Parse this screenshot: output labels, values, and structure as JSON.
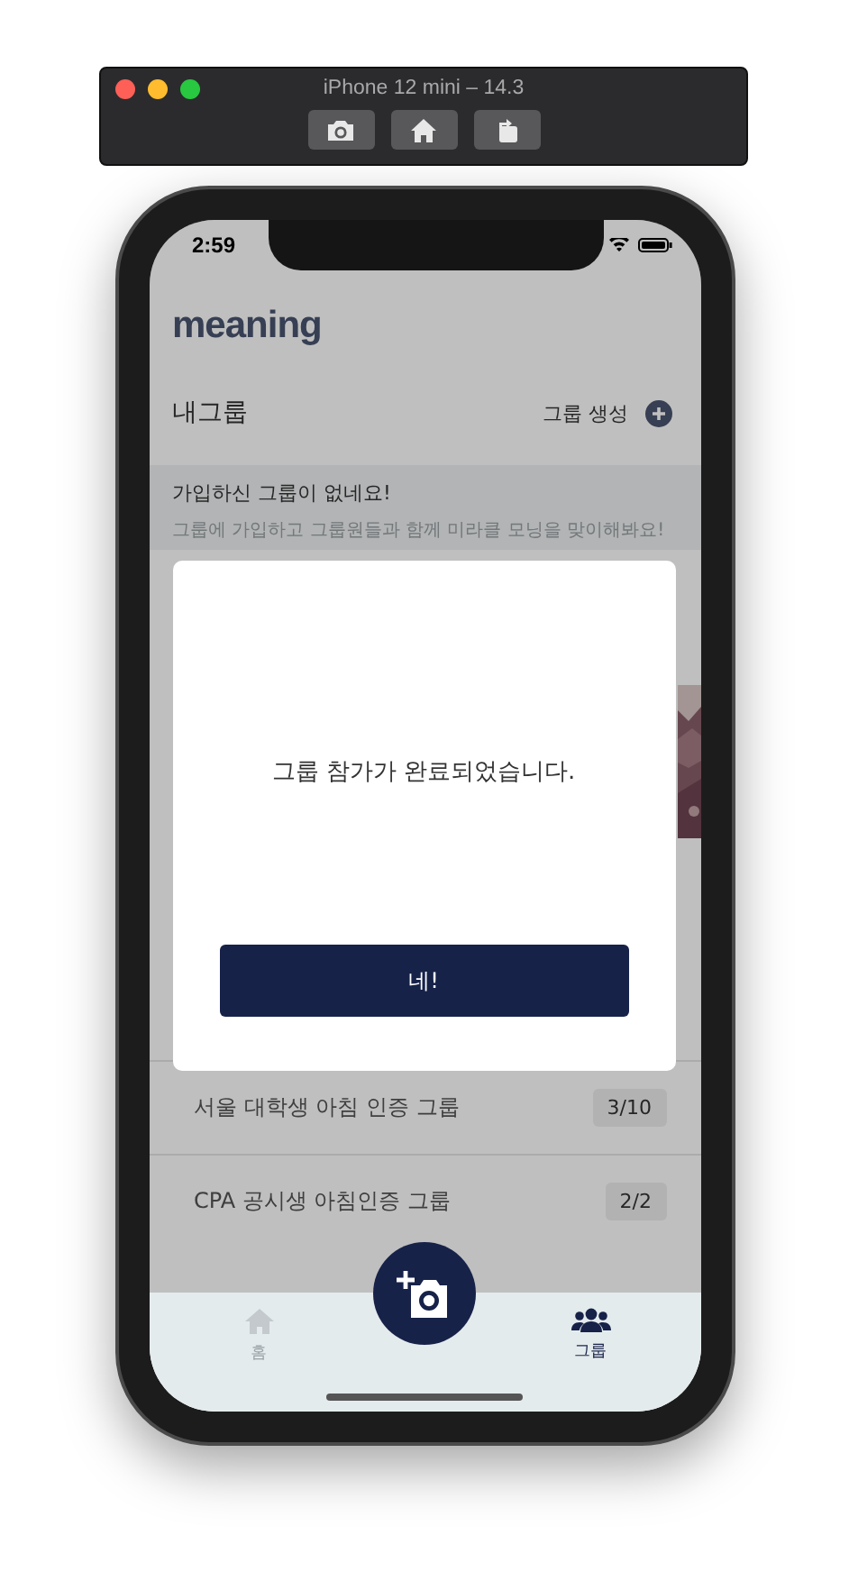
{
  "simulator": {
    "title": "iPhone 12 mini – 14.3"
  },
  "status_bar": {
    "time": "2:59"
  },
  "app": {
    "logo": "meaning",
    "section_title": "내그룹",
    "create_label": "그룹 생성",
    "empty_banner": {
      "title": "가입하신 그룹이 없네요!",
      "message": "그룹에 가입하고 그룹원들과 함께 미라클 모닝을 맞이해봐요!"
    },
    "groups": [
      {
        "name": "서울 대학생 아침 인증 그룹",
        "count": "3/10"
      },
      {
        "name": "CPA 공시생 아침인증 그룹",
        "count": "2/2"
      }
    ]
  },
  "dialog": {
    "message": "그룹 참가가 완료되었습니다.",
    "button": "네!"
  },
  "tab_bar": {
    "items": [
      {
        "kind": "home",
        "label": "홈",
        "selected": false
      },
      {
        "kind": "group",
        "label": "그룹",
        "selected": true
      }
    ]
  }
}
